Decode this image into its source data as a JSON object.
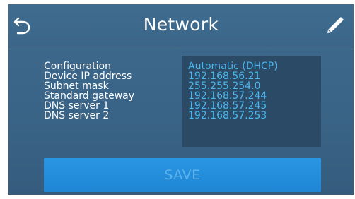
{
  "header": {
    "title": "Network",
    "back_icon": "back-arrow-icon",
    "edit_icon": "pencil-icon"
  },
  "network": {
    "fields": [
      {
        "label": "Configuration",
        "value": "Automatic (DHCP)"
      },
      {
        "label": "Device IP address",
        "value": "192.168.56.21"
      },
      {
        "label": "Subnet mask",
        "value": "255.255.254.0"
      },
      {
        "label": "Standard gateway",
        "value": "192.168.57.244"
      },
      {
        "label": "DNS server 1",
        "value": "192.168.57.245"
      },
      {
        "label": "DNS server 2",
        "value": "192.168.57.253"
      }
    ]
  },
  "actions": {
    "save_label": "SAVE"
  },
  "colors": {
    "background": "#3b6689",
    "value_panel": "#2a4a65",
    "value_text": "#4ab7f0",
    "save_button": "#2290dd",
    "save_text": "#5cb2ee"
  }
}
